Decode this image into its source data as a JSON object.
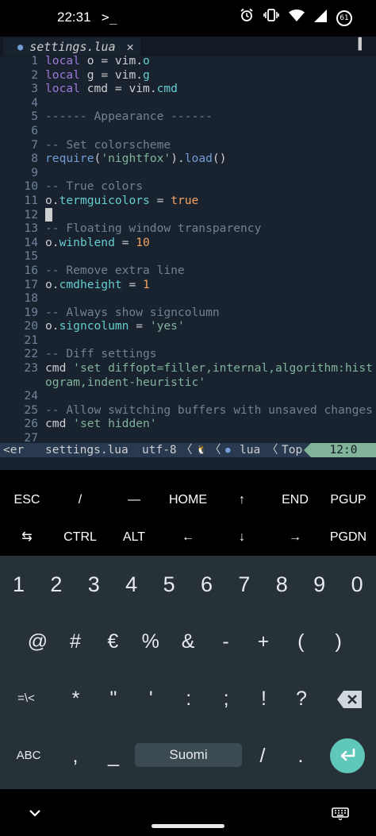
{
  "status_bar": {
    "time": "22:31",
    "terminal_icon": ">_",
    "alarm_icon": "alarm-clock-icon",
    "vibrate_icon": "vibrate-icon",
    "wifi_icon": "wifi-icon",
    "signal_icon": "signal-icon",
    "battery_level": "61"
  },
  "editor": {
    "tab": {
      "filename": "settings.lua",
      "close_glyph": "✕",
      "tabs_button": "▌"
    },
    "lines": [
      {
        "n": "1",
        "t": [
          [
            "kw",
            "local"
          ],
          [
            "op",
            " "
          ],
          [
            "id",
            "o"
          ],
          [
            "op",
            " = "
          ],
          [
            "id",
            "vim"
          ],
          [
            "op",
            "."
          ],
          [
            "fld",
            "o"
          ]
        ]
      },
      {
        "n": "2",
        "t": [
          [
            "kw",
            "local"
          ],
          [
            "op",
            " "
          ],
          [
            "id",
            "g"
          ],
          [
            "op",
            " = "
          ],
          [
            "id",
            "vim"
          ],
          [
            "op",
            "."
          ],
          [
            "fld",
            "g"
          ]
        ]
      },
      {
        "n": "3",
        "t": [
          [
            "kw",
            "local"
          ],
          [
            "op",
            " "
          ],
          [
            "id",
            "cmd"
          ],
          [
            "op",
            " = "
          ],
          [
            "id",
            "vim"
          ],
          [
            "op",
            "."
          ],
          [
            "fld",
            "cmd"
          ]
        ]
      },
      {
        "n": "4",
        "t": []
      },
      {
        "n": "5",
        "t": [
          [
            "com",
            "------ Appearance ------"
          ]
        ]
      },
      {
        "n": "6",
        "t": []
      },
      {
        "n": "7",
        "t": [
          [
            "com",
            "-- Set colorscheme"
          ]
        ]
      },
      {
        "n": "8",
        "t": [
          [
            "fn",
            "require"
          ],
          [
            "op",
            "("
          ],
          [
            "str",
            "'nightfox'"
          ],
          [
            "op",
            ")."
          ],
          [
            "fn",
            "load"
          ],
          [
            "op",
            "()"
          ]
        ]
      },
      {
        "n": "9",
        "t": []
      },
      {
        "n": "10",
        "t": [
          [
            "com",
            "-- True colors"
          ]
        ]
      },
      {
        "n": "11",
        "t": [
          [
            "id",
            "o"
          ],
          [
            "op",
            "."
          ],
          [
            "fld",
            "termguicolors"
          ],
          [
            "op",
            " = "
          ],
          [
            "num",
            "true"
          ]
        ]
      },
      {
        "n": "12",
        "t": [],
        "cursor": true
      },
      {
        "n": "13",
        "t": [
          [
            "com",
            "-- Floating window transparency"
          ]
        ]
      },
      {
        "n": "14",
        "t": [
          [
            "id",
            "o"
          ],
          [
            "op",
            "."
          ],
          [
            "fld",
            "winblend"
          ],
          [
            "op",
            " = "
          ],
          [
            "num",
            "10"
          ]
        ]
      },
      {
        "n": "15",
        "t": []
      },
      {
        "n": "16",
        "t": [
          [
            "com",
            "-- Remove extra line"
          ]
        ]
      },
      {
        "n": "17",
        "t": [
          [
            "id",
            "o"
          ],
          [
            "op",
            "."
          ],
          [
            "fld",
            "cmdheight"
          ],
          [
            "op",
            " = "
          ],
          [
            "num",
            "1"
          ]
        ]
      },
      {
        "n": "18",
        "t": []
      },
      {
        "n": "19",
        "t": [
          [
            "com",
            "-- Always show signcolumn"
          ]
        ]
      },
      {
        "n": "20",
        "t": [
          [
            "id",
            "o"
          ],
          [
            "op",
            "."
          ],
          [
            "fld",
            "signcolumn"
          ],
          [
            "op",
            " = "
          ],
          [
            "str",
            "'yes'"
          ]
        ]
      },
      {
        "n": "21",
        "t": []
      },
      {
        "n": "22",
        "t": [
          [
            "com",
            "-- Diff settings"
          ]
        ]
      },
      {
        "n": "23",
        "t": [
          [
            "id",
            "cmd"
          ],
          [
            "op",
            " "
          ],
          [
            "str",
            "'set diffopt=filler,internal,algorithm:hist"
          ]
        ]
      },
      {
        "n": "",
        "t": [
          [
            "str",
            "ogram,indent-heuristic'"
          ]
        ]
      },
      {
        "n": "24",
        "t": []
      },
      {
        "n": "25",
        "t": [
          [
            "com",
            "-- Allow switching buffers with unsaved changes"
          ]
        ]
      },
      {
        "n": "26",
        "t": [
          [
            "id",
            "cmd"
          ],
          [
            "op",
            " "
          ],
          [
            "str",
            "'set hidden'"
          ]
        ]
      },
      {
        "n": "27",
        "t": []
      }
    ],
    "statusline": {
      "mode": "<er",
      "filename": "settings.lua",
      "encoding": "utf-8",
      "sep1": "〈",
      "os_icon": "linux-icon",
      "os_glyph": "🐧",
      "sep2": "〈",
      "filetype_icon": "lua-icon",
      "filetype": "lua",
      "sep3": "〈",
      "scroll": "Top",
      "position": "12:0"
    }
  },
  "extra_keys": {
    "row1": [
      "ESC",
      "/",
      "—",
      "HOME",
      "↑",
      "END",
      "PGUP"
    ],
    "row2": [
      "⇆",
      "CTRL",
      "ALT",
      "←",
      "↓",
      "→",
      "PGDN"
    ]
  },
  "keyboard": {
    "row1": [
      "1",
      "2",
      "3",
      "4",
      "5",
      "6",
      "7",
      "8",
      "9",
      "0"
    ],
    "row2": [
      "@",
      "#",
      "€",
      "%",
      "&",
      "-",
      "+",
      "(",
      ")"
    ],
    "row3": [
      "=\\<",
      "*",
      "\"",
      "'",
      ":",
      ";",
      "!",
      "?"
    ],
    "row4": {
      "abc": "ABC",
      "comma": ",",
      "underscore": "_",
      "space": "Suomi",
      "slash": "/",
      "period": "."
    }
  },
  "nav_bar": {
    "back_icon": "chevron-down-icon",
    "keyboard_icon": "keyboard-icon"
  }
}
